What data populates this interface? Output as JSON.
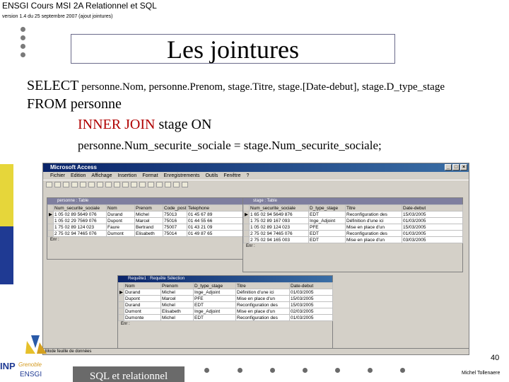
{
  "header": {
    "course": "ENSGI Cours MSI 2A Relationnel et SQL",
    "version": "version 1.4 du 25 septembre 2007 (ajout jointures)"
  },
  "slide": {
    "title": "Les jointures",
    "sql_select_kw": "SELECT",
    "sql_select_fields": " personne.Nom, personne.Prenom, stage.Titre, stage.[Date-debut], stage.D_type_stage",
    "sql_from": "FROM personne",
    "sql_join_kw": "INNER JOIN",
    "sql_join_rest": " stage ON",
    "sql_on": "personne.Num_securite_sociale = stage.Num_securite_sociale;"
  },
  "access": {
    "window_title": "Microsoft Access",
    "menu": [
      "Fichier",
      "Edition",
      "Affichage",
      "Insertion",
      "Format",
      "Enregistrements",
      "Outils",
      "Fenêtre",
      "?"
    ],
    "personne_table": {
      "title": "personne : Table",
      "headers": [
        "Num_securite_sociale",
        "Nom",
        "Prenom",
        "Code_post",
        "Telephone"
      ],
      "rows": [
        [
          "1 05 02 89 5649 076",
          "Durand",
          "Michel",
          "75013",
          "01 45 67 89"
        ],
        [
          "1 05 02 29 7569 076",
          "Dupont",
          "Marcel",
          "75016",
          "01 44 55 66"
        ],
        [
          "1 75 02 89 124 023",
          "Faure",
          "Bertrand",
          "75007",
          "01 43 21 09"
        ],
        [
          "2 75 02 94 7465 076",
          "Dumont",
          "Elisabeth",
          "75014",
          "01 49 87 65"
        ]
      ],
      "record_label": "Enr :"
    },
    "stage_table": {
      "title": "stage : Table",
      "headers": [
        "Num_securite_sociale",
        "D_type_stage",
        "Titre",
        "Date-debut"
      ],
      "rows": [
        [
          "1 65 02 94 5649 876",
          "EDT",
          "Reconfiguration des",
          "15/03/2005"
        ],
        [
          "1 75 02 89 167 093",
          "Inge_Adjoint",
          "Définition d'une ici",
          "01/03/2005"
        ],
        [
          "1 05 02 89 124 023",
          "PFE",
          "Mise en place d'un",
          "15/03/2005"
        ],
        [
          "2 75 02 94 7465 076",
          "EDT",
          "Reconfiguration des",
          "01/03/2005"
        ],
        [
          "2 75 02 94 165 003",
          "EDT",
          "Mise en place d'un",
          "03/03/2005"
        ]
      ],
      "record_label": "Enr :"
    },
    "query": {
      "title": "Requête1 : Requête Sélection",
      "headers": [
        "Nom",
        "Prenom",
        "D_type_stage",
        "Titre",
        "Date-debut"
      ],
      "rows": [
        [
          "Durand",
          "Michel",
          "Inge_Adjoint",
          "Définition d'une ici",
          "01/03/2005"
        ],
        [
          "Dupont",
          "Marcel",
          "PFE",
          "Mise en place d'un",
          "15/03/2005"
        ],
        [
          "Durand",
          "Michel",
          "EDT",
          "Reconfiguration des",
          "15/03/2005"
        ],
        [
          "Dumont",
          "Elisabeth",
          "Inge_Adjoint",
          "Mise en place d'un",
          "02/03/2005"
        ],
        [
          "Dumonte",
          "Michel",
          "EDT",
          "Reconfiguration des",
          "01/03/2005"
        ]
      ],
      "record_label": "Enr :"
    },
    "status_bar": "Mode feuille de données"
  },
  "footer": {
    "label": "SQL et relationnel",
    "page": "40",
    "author": "Michel Tollenaere",
    "logo_text_inp": "INP",
    "logo_text_school": "Grenoble",
    "logo_text_ensgi": "ENSGI"
  },
  "colors": {
    "accent_red": "#b00000",
    "bar_blue": "#1f3a93",
    "bar_yellow": "#e6d63a",
    "footer_gray": "#6a6a6a"
  }
}
